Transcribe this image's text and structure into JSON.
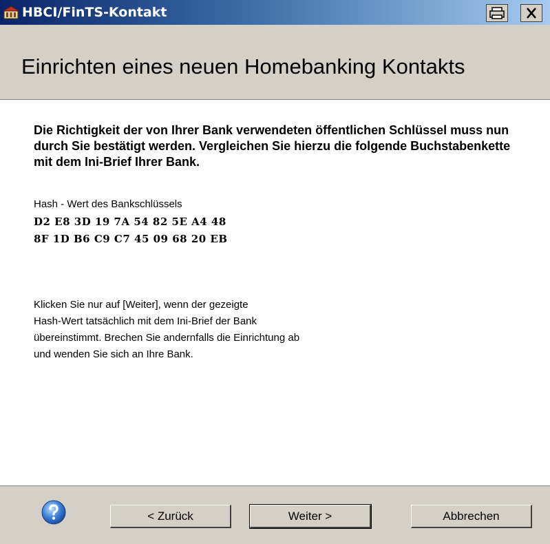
{
  "window": {
    "title": "HBCI/FinTS-Kontakt",
    "icons": [
      "app-icon",
      "print-icon",
      "close-icon"
    ]
  },
  "header": {
    "title": "Einrichten eines neuen Homebanking Kontakts"
  },
  "content": {
    "intro": "Die Richtigkeit der von Ihrer Bank verwendeten öffentlichen Schlüssel muss nun durch Sie bestätigt werden. Vergleichen Sie hierzu die folgende Buchstabenkette mit dem Ini-Brief Ihrer Bank.",
    "hash_label": "Hash - Wert des Bankschlüssels",
    "hash_lines": [
      "D2 E8 3D 19 7A 54 82 5E A4 48",
      "8F 1D B6 C9 C7 45 09 68 20 EB"
    ],
    "instructions": [
      "Klicken Sie nur auf [Weiter], wenn der gezeigte",
      "Hash-Wert tatsächlich mit dem Ini-Brief der Bank",
      "übereinstimmt. Brechen Sie andernfalls die Einrichtung ab",
      "und wenden Sie sich an Ihre Bank."
    ]
  },
  "footer": {
    "help_icon": "help-icon",
    "back_label": "< Zurück",
    "next_label": "Weiter >",
    "cancel_label": "Abbrechen"
  },
  "colors": {
    "titlebar_start": "#0a246a",
    "titlebar_end": "#a6caf0",
    "dialog_face": "#d4d0c8",
    "content_bg": "#ffffff"
  }
}
